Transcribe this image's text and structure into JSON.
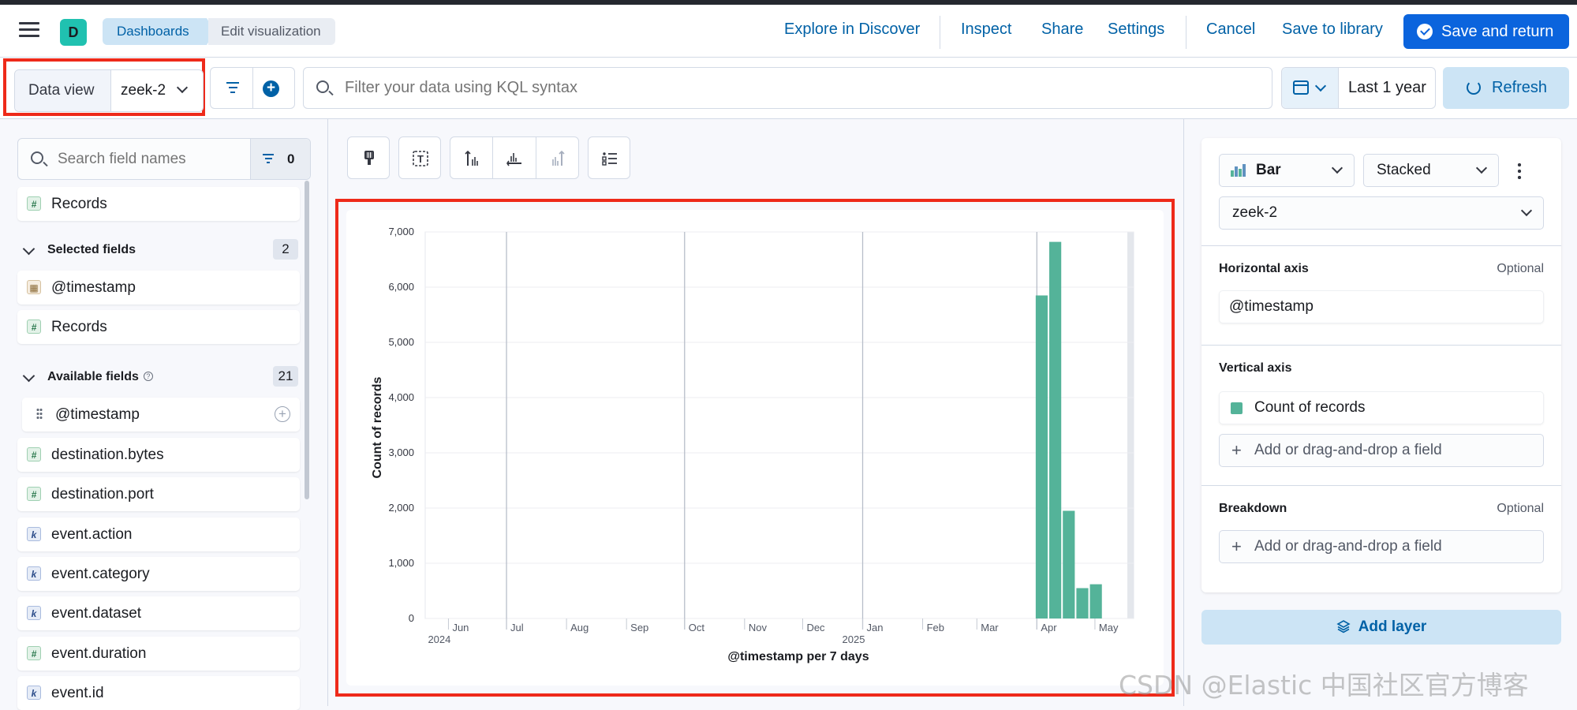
{
  "header": {
    "space_initial": "D",
    "breadcrumbs": [
      "Dashboards",
      "Edit visualization"
    ],
    "links": [
      "Explore in Discover",
      "Inspect",
      "Share",
      "Settings",
      "Cancel",
      "Save to library"
    ],
    "primary_button": "Save and return"
  },
  "query_bar": {
    "data_view_label": "Data view",
    "data_view_value": "zeek-2",
    "search_placeholder": "Filter your data using KQL syntax",
    "time_range": "Last 1 year",
    "refresh_label": "Refresh"
  },
  "field_list": {
    "search_placeholder": "Search field names",
    "filter_count": "0",
    "top_item": {
      "type": "number",
      "name": "Records"
    },
    "selected_label": "Selected fields",
    "selected_count": "2",
    "selected": [
      {
        "type": "date",
        "name": "@timestamp"
      },
      {
        "type": "number",
        "name": "Records"
      }
    ],
    "available_label": "Available fields",
    "available_count": "21",
    "available": [
      {
        "type": "drag",
        "name": "@timestamp"
      },
      {
        "type": "number",
        "name": "destination.bytes"
      },
      {
        "type": "number",
        "name": "destination.port"
      },
      {
        "type": "keyword",
        "name": "event.action"
      },
      {
        "type": "keyword",
        "name": "event.category"
      },
      {
        "type": "keyword",
        "name": "event.dataset"
      },
      {
        "type": "number",
        "name": "event.duration"
      },
      {
        "type": "keyword",
        "name": "event.id"
      }
    ]
  },
  "toolbar_icons": [
    "paint-brush-icon",
    "text-icon",
    "left-axis-icon",
    "bottom-axis-icon",
    "right-axis-icon",
    "legend-icon"
  ],
  "chart_data": {
    "type": "bar",
    "xlabel": "@timestamp per 7 days",
    "ylabel": "Count of records",
    "ylim": [
      0,
      7000
    ],
    "yticks": [
      "0",
      "1,000",
      "2,000",
      "3,000",
      "4,000",
      "5,000",
      "6,000",
      "7,000"
    ],
    "month_ticks": [
      {
        "label": "Jun",
        "sub": "2024"
      },
      {
        "label": "Jul",
        "sub": ""
      },
      {
        "label": "Aug",
        "sub": ""
      },
      {
        "label": "Sep",
        "sub": ""
      },
      {
        "label": "Oct",
        "sub": ""
      },
      {
        "label": "Nov",
        "sub": ""
      },
      {
        "label": "Dec",
        "sub": ""
      },
      {
        "label": "Jan",
        "sub": "2025"
      },
      {
        "label": "Feb",
        "sub": ""
      },
      {
        "label": "Mar",
        "sub": ""
      },
      {
        "label": "Apr",
        "sub": ""
      },
      {
        "label": "May",
        "sub": ""
      }
    ],
    "series": [
      {
        "values": [
          {
            "week_start": "2025-03-31",
            "count": 5850
          },
          {
            "week_start": "2025-04-07",
            "count": 6820
          },
          {
            "week_start": "2025-04-14",
            "count": 1950
          },
          {
            "week_start": "2025-04-21",
            "count": 550
          },
          {
            "week_start": "2025-04-28",
            "count": 620
          }
        ]
      }
    ],
    "bar_color": "#54b399",
    "grid": true
  },
  "config_panel": {
    "chart_type": "Bar",
    "mode": "Stacked",
    "data_view": "zeek-2",
    "horizontal_axis": {
      "title": "Horizontal axis",
      "optional": "Optional",
      "field": "@timestamp"
    },
    "vertical_axis": {
      "title": "Vertical axis",
      "field": "Count of records",
      "add": "Add or drag-and-drop a field"
    },
    "breakdown": {
      "title": "Breakdown",
      "optional": "Optional",
      "add": "Add or drag-and-drop a field"
    },
    "add_layer": "Add layer"
  },
  "watermark": "CSDN @Elastic 中国社区官方博客"
}
